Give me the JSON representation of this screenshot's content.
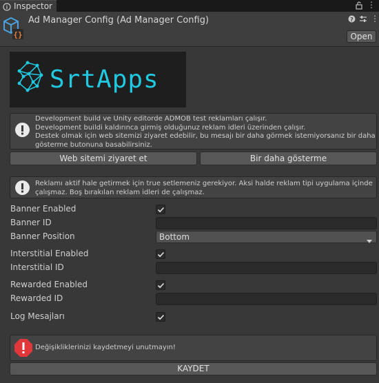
{
  "tab": {
    "label": "Inspector"
  },
  "header": {
    "title": "Ad Manager Config (Ad Manager Config)",
    "open_label": "Open"
  },
  "logo": {
    "text": "SrtApps",
    "accent": "#22c8e0"
  },
  "info1": {
    "lines": [
      "Development build ve Unity editorde ADMOB test reklamları çalışır.",
      "Development buildi kaldırınca girmiş olduğunuz reklam idleri üzerinden çalışır.",
      " Destek olmak için web sitemizi ziyaret edebilir, bu mesajı bir daha görmek istemiyorsanız bir daha",
      "gösterme butonuna basabilirsiniz."
    ]
  },
  "buttons": {
    "visit_site": "Web sitemi ziyaret et",
    "dont_show": "Bir daha gösterme"
  },
  "info2": {
    "lines": [
      "Reklamı aktif hale getirmek için true setlemeniz gerekiyor. Aksi halde reklam tipi uygulama içinde",
      "çalışmaz. Boş bırakılan reklam idleri de çalışmaz."
    ]
  },
  "fields": {
    "banner_enabled": {
      "label": "Banner Enabled",
      "checked": true
    },
    "banner_id": {
      "label": "Banner ID",
      "value": ""
    },
    "banner_position": {
      "label": "Banner Position",
      "value": "Bottom"
    },
    "interstitial_enabled": {
      "label": "Interstitial Enabled",
      "checked": true
    },
    "interstitial_id": {
      "label": "Interstitial ID",
      "value": ""
    },
    "rewarded_enabled": {
      "label": "Rewarded Enabled",
      "checked": true
    },
    "rewarded_id": {
      "label": "Rewarded ID",
      "value": ""
    },
    "log_messages": {
      "label": "Log Mesajları",
      "checked": true
    }
  },
  "warning": {
    "text": "Değişikliklerinizi kaydetmeyi unutmayın!",
    "color": "#e0373a"
  },
  "save": {
    "label": "KAYDET"
  }
}
